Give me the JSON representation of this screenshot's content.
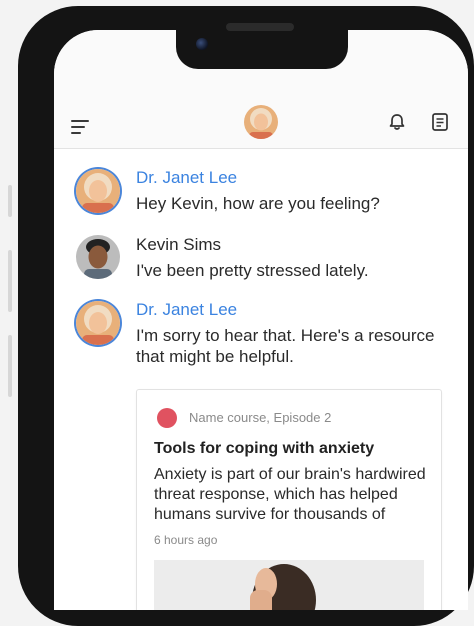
{
  "header": {
    "menu_icon": "hamburger-menu-icon",
    "bell_icon": "bell-icon",
    "notes_icon": "notes-icon"
  },
  "messages": [
    {
      "sender": "Dr. Janet Lee",
      "text": "Hey Kevin, how are you feeling?"
    },
    {
      "sender": "Kevin Sims",
      "text": "I've been pretty stressed lately."
    },
    {
      "sender": "Dr. Janet Lee",
      "text": "I'm sorry to hear that. Here's a resource that might be helpful."
    }
  ],
  "resource_card": {
    "course": "Name course, Episode 2",
    "title": "Tools for coping with anxiety",
    "body": "Anxiety is part of our brain's hardwired threat response, which has helped humans survive for thousands of",
    "time": "6 hours ago",
    "dot_color": "#e05260"
  },
  "colors": {
    "doctor_name": "#3b83e0",
    "avatar_ring": "#4b86d9"
  }
}
